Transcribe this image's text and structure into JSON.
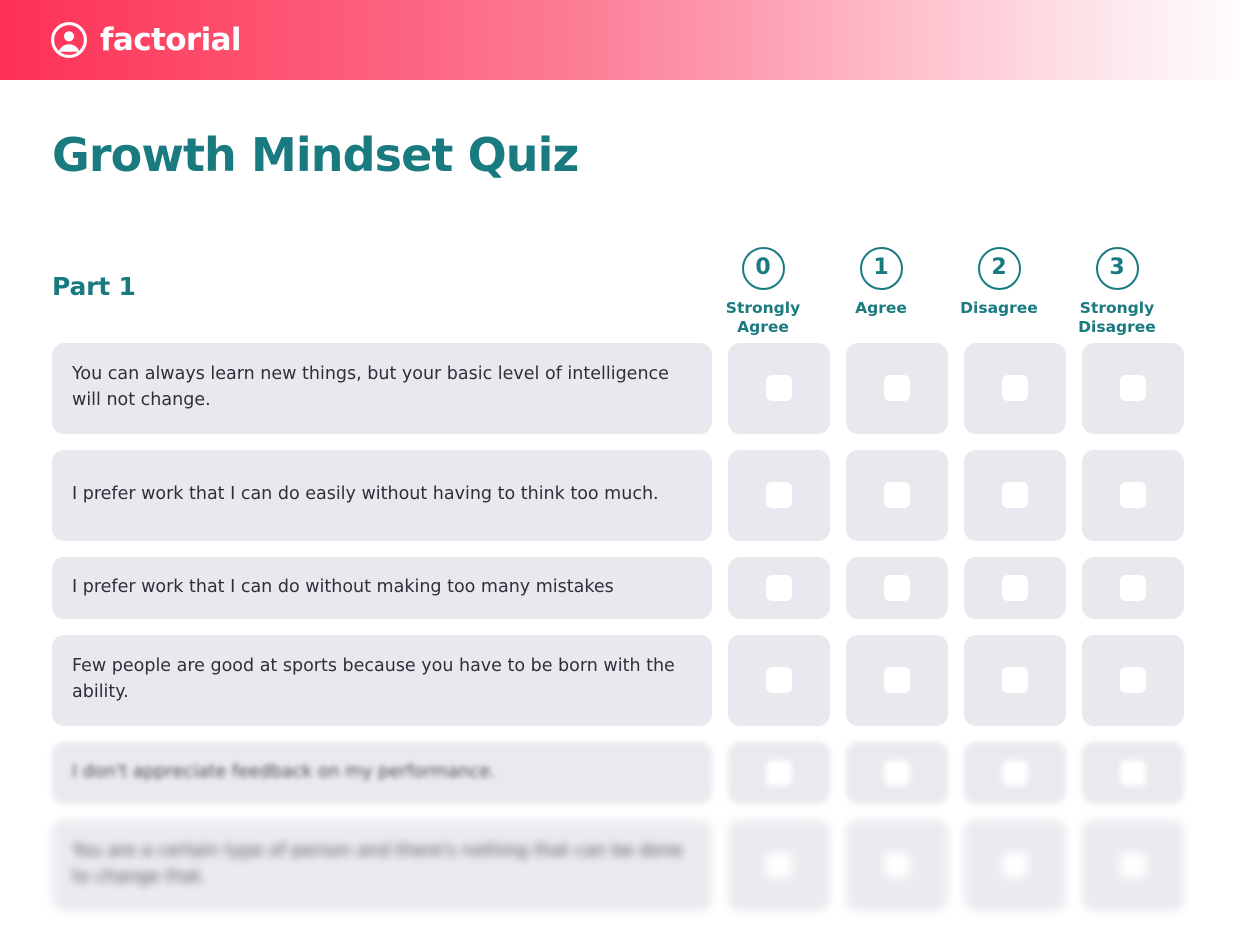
{
  "header": {
    "brand_name": "factorial",
    "logo_icon": "person-in-circle-icon",
    "gradient_start": "#fd2f56",
    "gradient_end": "#fffcfd"
  },
  "page": {
    "title": "Growth Mindset Quiz",
    "accent_color": "#197A80",
    "row_background": "#E8E8EE"
  },
  "quiz": {
    "part_label": "Part 1",
    "scale": [
      {
        "value": "0",
        "label": "Strongly Agree"
      },
      {
        "value": "1",
        "label": "Agree"
      },
      {
        "value": "2",
        "label": "Disagree"
      },
      {
        "value": "3",
        "label": "Strongly Disagree"
      }
    ],
    "questions": [
      {
        "text": "You can always learn new things, but your basic level of intelligence will not change."
      },
      {
        "text": "I prefer work that I can do easily without having to think too much."
      },
      {
        "text": "I prefer work that I can do without making too many mistakes"
      },
      {
        "text": "Few people are good at sports because you have to be born with the ability."
      },
      {
        "text": "I don't appreciate feedback on my performance."
      },
      {
        "text": "You are a certain type of person and there's nothing that can be done to change that."
      }
    ]
  }
}
